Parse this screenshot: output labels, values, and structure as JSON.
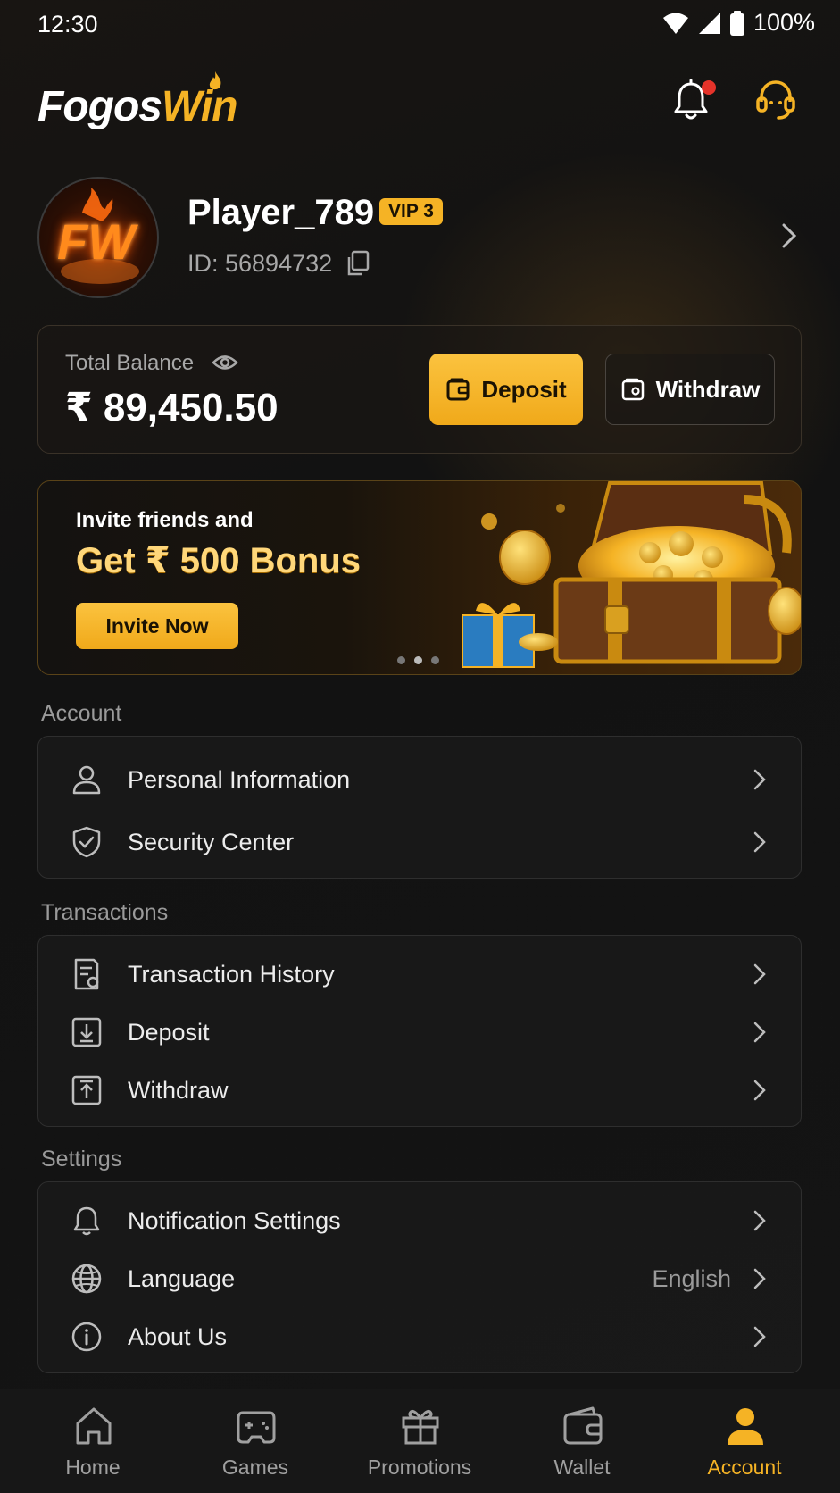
{
  "status_bar": {
    "time": "12:30",
    "battery": "100%"
  },
  "header": {
    "logo_part1": "Fogos",
    "logo_part2": "Win"
  },
  "profile": {
    "avatar_text": "FW",
    "username": "Player_789",
    "vip": "VIP 3",
    "id_text": "ID: 56894732"
  },
  "balance": {
    "label": "Total Balance",
    "amount": "₹ 89,450.50",
    "deposit_label": "Deposit",
    "withdraw_label": "Withdraw"
  },
  "banner": {
    "subtitle": "Invite friends and",
    "title": "Get ₹ 500 Bonus",
    "button": "Invite Now",
    "slide_count": 3,
    "active_slide": 2
  },
  "sections": {
    "account": {
      "title": "Account",
      "items": [
        {
          "label": "Personal Information",
          "icon": "user-icon"
        },
        {
          "label": "Security Center",
          "icon": "shield-check-icon"
        }
      ]
    },
    "transactions": {
      "title": "Transactions",
      "items": [
        {
          "label": "Transaction History",
          "icon": "receipt-icon"
        },
        {
          "label": "Deposit",
          "icon": "download-box-icon"
        },
        {
          "label": "Withdraw",
          "icon": "upload-box-icon"
        }
      ]
    },
    "settings": {
      "title": "Settings",
      "items": [
        {
          "label": "Notification Settings",
          "icon": "bell-icon"
        },
        {
          "label": "Language",
          "value": "English",
          "icon": "globe-icon"
        },
        {
          "label": "About Us",
          "icon": "info-icon"
        }
      ]
    }
  },
  "bottom_nav": {
    "items": [
      {
        "label": "Home",
        "icon": "home-icon"
      },
      {
        "label": "Games",
        "icon": "gamepad-icon"
      },
      {
        "label": "Promotions",
        "icon": "gift-icon"
      },
      {
        "label": "Wallet",
        "icon": "wallet-icon"
      },
      {
        "label": "Account",
        "icon": "account-icon",
        "active": true
      }
    ]
  },
  "colors": {
    "accent": "#f5b325",
    "background": "#121212",
    "notification_dot": "#e5332a"
  }
}
